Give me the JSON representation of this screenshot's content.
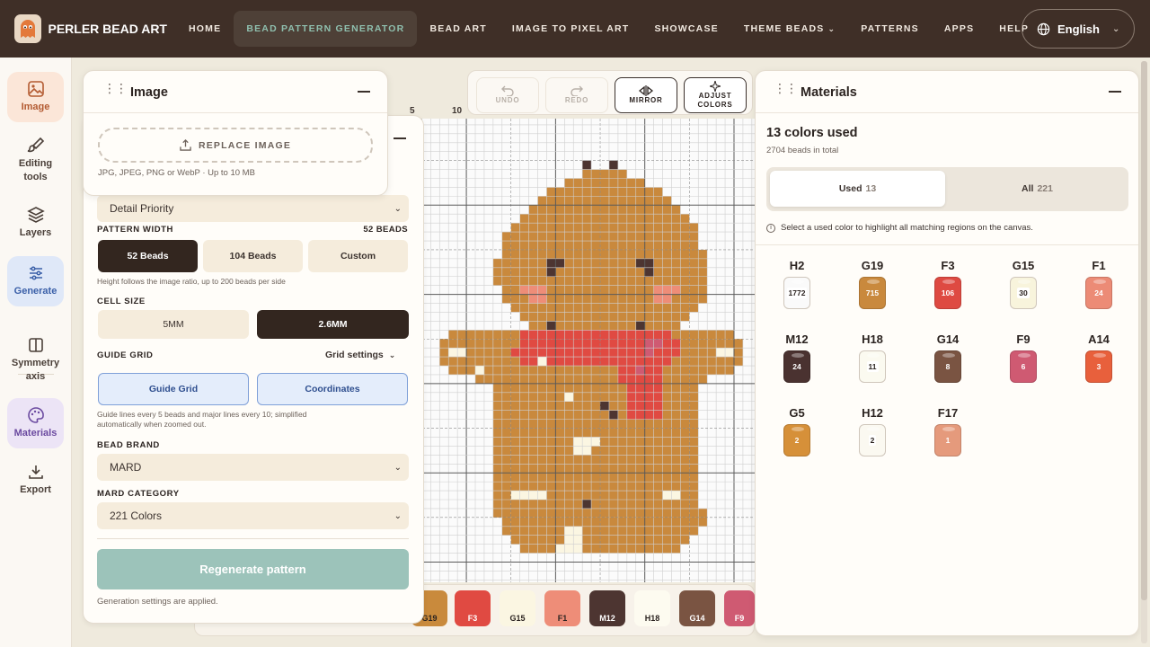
{
  "app": {
    "name": "PERLER BEAD ART"
  },
  "nav": {
    "items": [
      "HOME",
      "BEAD PATTERN GENERATOR",
      "BEAD ART",
      "IMAGE TO PIXEL ART",
      "SHOWCASE",
      "THEME BEADS",
      "PATTERNS",
      "APPS",
      "HELP"
    ],
    "active": "BEAD PATTERN GENERATOR",
    "language": "English"
  },
  "sidebar": {
    "items": [
      {
        "label": "Image",
        "icon": "image-icon"
      },
      {
        "label": "Editing tools",
        "icon": "brush-icon"
      },
      {
        "label": "Layers",
        "icon": "layers-icon"
      },
      {
        "label": "Generate",
        "icon": "sliders-icon"
      },
      {
        "label": "Symmetry axis",
        "icon": "symmetry-icon"
      },
      {
        "label": "Materials",
        "icon": "palette-icon"
      },
      {
        "label": "Export",
        "icon": "download-icon"
      }
    ]
  },
  "image_panel": {
    "title": "Image",
    "replace_label": "REPLACE IMAGE",
    "file_hint": "JPG, JPEG, PNG or WebP · Up to 10 MB"
  },
  "generate_panel": {
    "mode_value": "Detail Priority",
    "pattern_width_label": "PATTERN WIDTH",
    "pattern_width_value": "52 BEADS",
    "width_options": [
      "52 Beads",
      "104 Beads",
      "Custom"
    ],
    "width_hint": "Height follows the image ratio, up to 200 beads per side",
    "cell_size_label": "CELL SIZE",
    "cell_size_options": [
      "5MM",
      "2.6MM"
    ],
    "guide_grid_label": "GUIDE GRID",
    "grid_settings_label": "Grid settings",
    "guide_options": [
      "Guide Grid",
      "Coordinates"
    ],
    "guide_hint_1": "Guide lines every 5 beads and major lines every 10; simplified",
    "guide_hint_2": "automatically when zoomed out.",
    "brand_label": "BEAD BRAND",
    "brand_value": "MARD",
    "category_label": "MARD CATEGORY",
    "category_value": "221 Colors",
    "regenerate_label": "Regenerate pattern",
    "applied_note": "Generation settings are applied."
  },
  "toolbar": {
    "undo": "UNDO",
    "redo": "REDO",
    "mirror": "MIRROR",
    "adjust_1": "ADJUST",
    "adjust_2": "COLORS"
  },
  "ruler": {
    "marks": [
      "5",
      "10"
    ]
  },
  "bottom_strip": {
    "chips": [
      {
        "code": "G19",
        "color": "#c98a3c",
        "text": "#2b2320"
      },
      {
        "code": "F3",
        "color": "#e04a42",
        "text": "#ffffff"
      },
      {
        "code": "G15",
        "color": "#fbf6e2",
        "text": "#2b2320"
      },
      {
        "code": "F1",
        "color": "#ee8d78",
        "text": "#2b2320"
      },
      {
        "code": "M12",
        "color": "#4d3531",
        "text": "#ffffff"
      },
      {
        "code": "H18",
        "color": "#fdfbf0",
        "text": "#2b2320"
      },
      {
        "code": "G14",
        "color": "#7a5442",
        "text": "#ffffff"
      },
      {
        "code": "F9",
        "color": "#cf5a72",
        "text": "#ffffff"
      }
    ]
  },
  "materials": {
    "title": "Materials",
    "colors_used": "13 colors used",
    "beads_total": "2704 beads in total",
    "tab_used": "Used",
    "tab_used_count": "13",
    "tab_all": "All",
    "tab_all_count": "221",
    "info": "Select a used color to highlight all matching regions on the canvas.",
    "beads": [
      {
        "code": "H2",
        "count": "1772",
        "color": "#fafafa"
      },
      {
        "code": "G19",
        "count": "715",
        "color": "#c9893d"
      },
      {
        "code": "F3",
        "count": "106",
        "color": "#de4a42"
      },
      {
        "code": "G15",
        "count": "30",
        "color": "#f8f4dc"
      },
      {
        "code": "F1",
        "count": "24",
        "color": "#ec8b76"
      },
      {
        "code": "M12",
        "count": "24",
        "color": "#4a3230"
      },
      {
        "code": "H18",
        "count": "11",
        "color": "#fbfaf0"
      },
      {
        "code": "G14",
        "count": "8",
        "color": "#7a5442"
      },
      {
        "code": "F9",
        "count": "6",
        "color": "#cf5a72"
      },
      {
        "code": "A14",
        "count": "3",
        "color": "#e8603c"
      },
      {
        "code": "G5",
        "count": "2",
        "color": "#d69039"
      },
      {
        "code": "H12",
        "count": "2",
        "color": "#fbf9f1"
      },
      {
        "code": "F17",
        "count": "1",
        "color": "#e59a7c"
      }
    ]
  },
  "colors": {
    "nav_bg": "#3f2f27",
    "accent_teal": "#8fbfae",
    "regenerate_bg": "#9cc3ba",
    "dark_btn": "#33261f"
  }
}
